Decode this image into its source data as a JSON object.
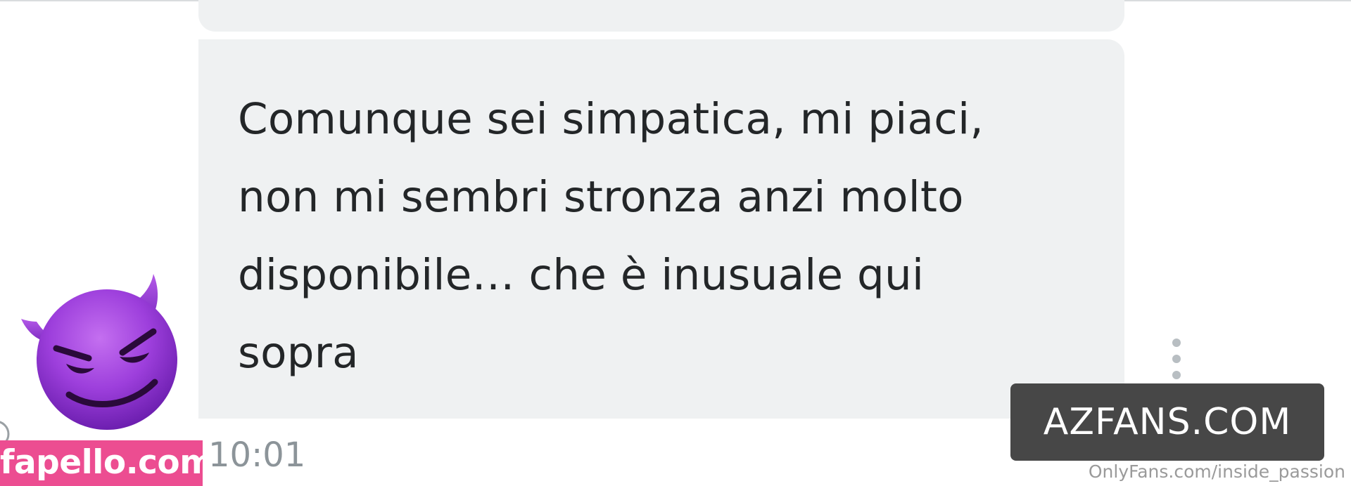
{
  "chat": {
    "message": "Comunque sei simpatica, mi piaci, non mi sembri stronza anzi molto disponibile… che è inusuale qui sopra",
    "timestamp": "10:01"
  },
  "icons": {
    "emoji": "smiling-face-with-horns-emoji",
    "more": "vertical-ellipsis-icon"
  },
  "watermarks": {
    "fapello": "fapello.com",
    "azfans": "AZFANS.COM",
    "onlyfans": "OnlyFans.com/inside_passion"
  },
  "colors": {
    "bubble": "#eff1f2",
    "text": "#232628",
    "timestamp": "#8c9499",
    "emoji": "#9b3fd8",
    "fapello_bg": "#ec4d91",
    "azfans_bg": "#474747"
  }
}
